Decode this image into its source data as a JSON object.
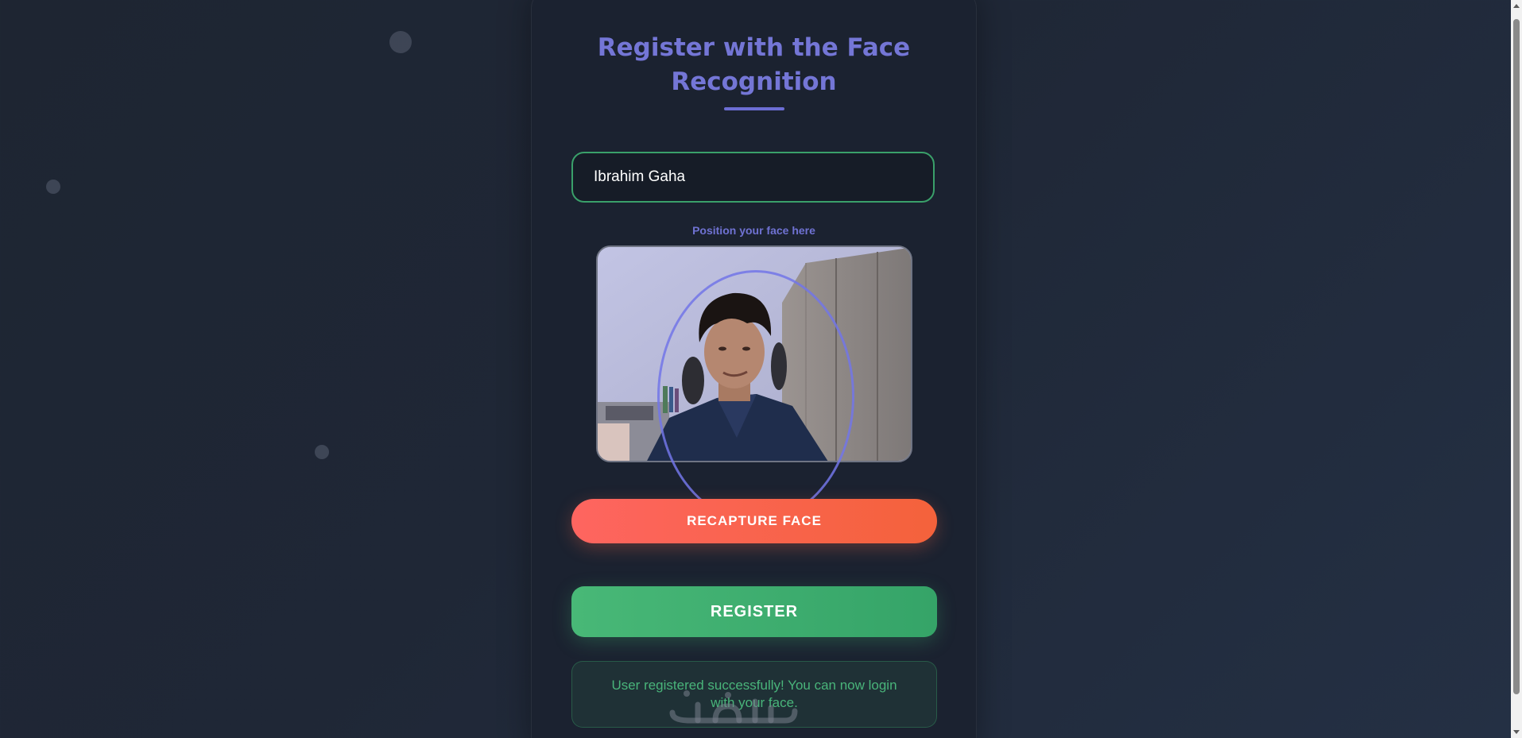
{
  "page": {
    "title": "Register with the Face Recognition"
  },
  "form": {
    "name_value": "Ibrahim Gaha"
  },
  "camera": {
    "hint": "Position your face here"
  },
  "buttons": {
    "recapture": "RECAPTURE FACE",
    "register": "REGISTER"
  },
  "status": {
    "message": "User registered successfully! You can now login with your face."
  },
  "watermark": {
    "text": "خمسات"
  },
  "colors": {
    "accent": "#7476d6",
    "success": "#49b47a",
    "recapture": "#fe6560",
    "register": "#48b877"
  }
}
